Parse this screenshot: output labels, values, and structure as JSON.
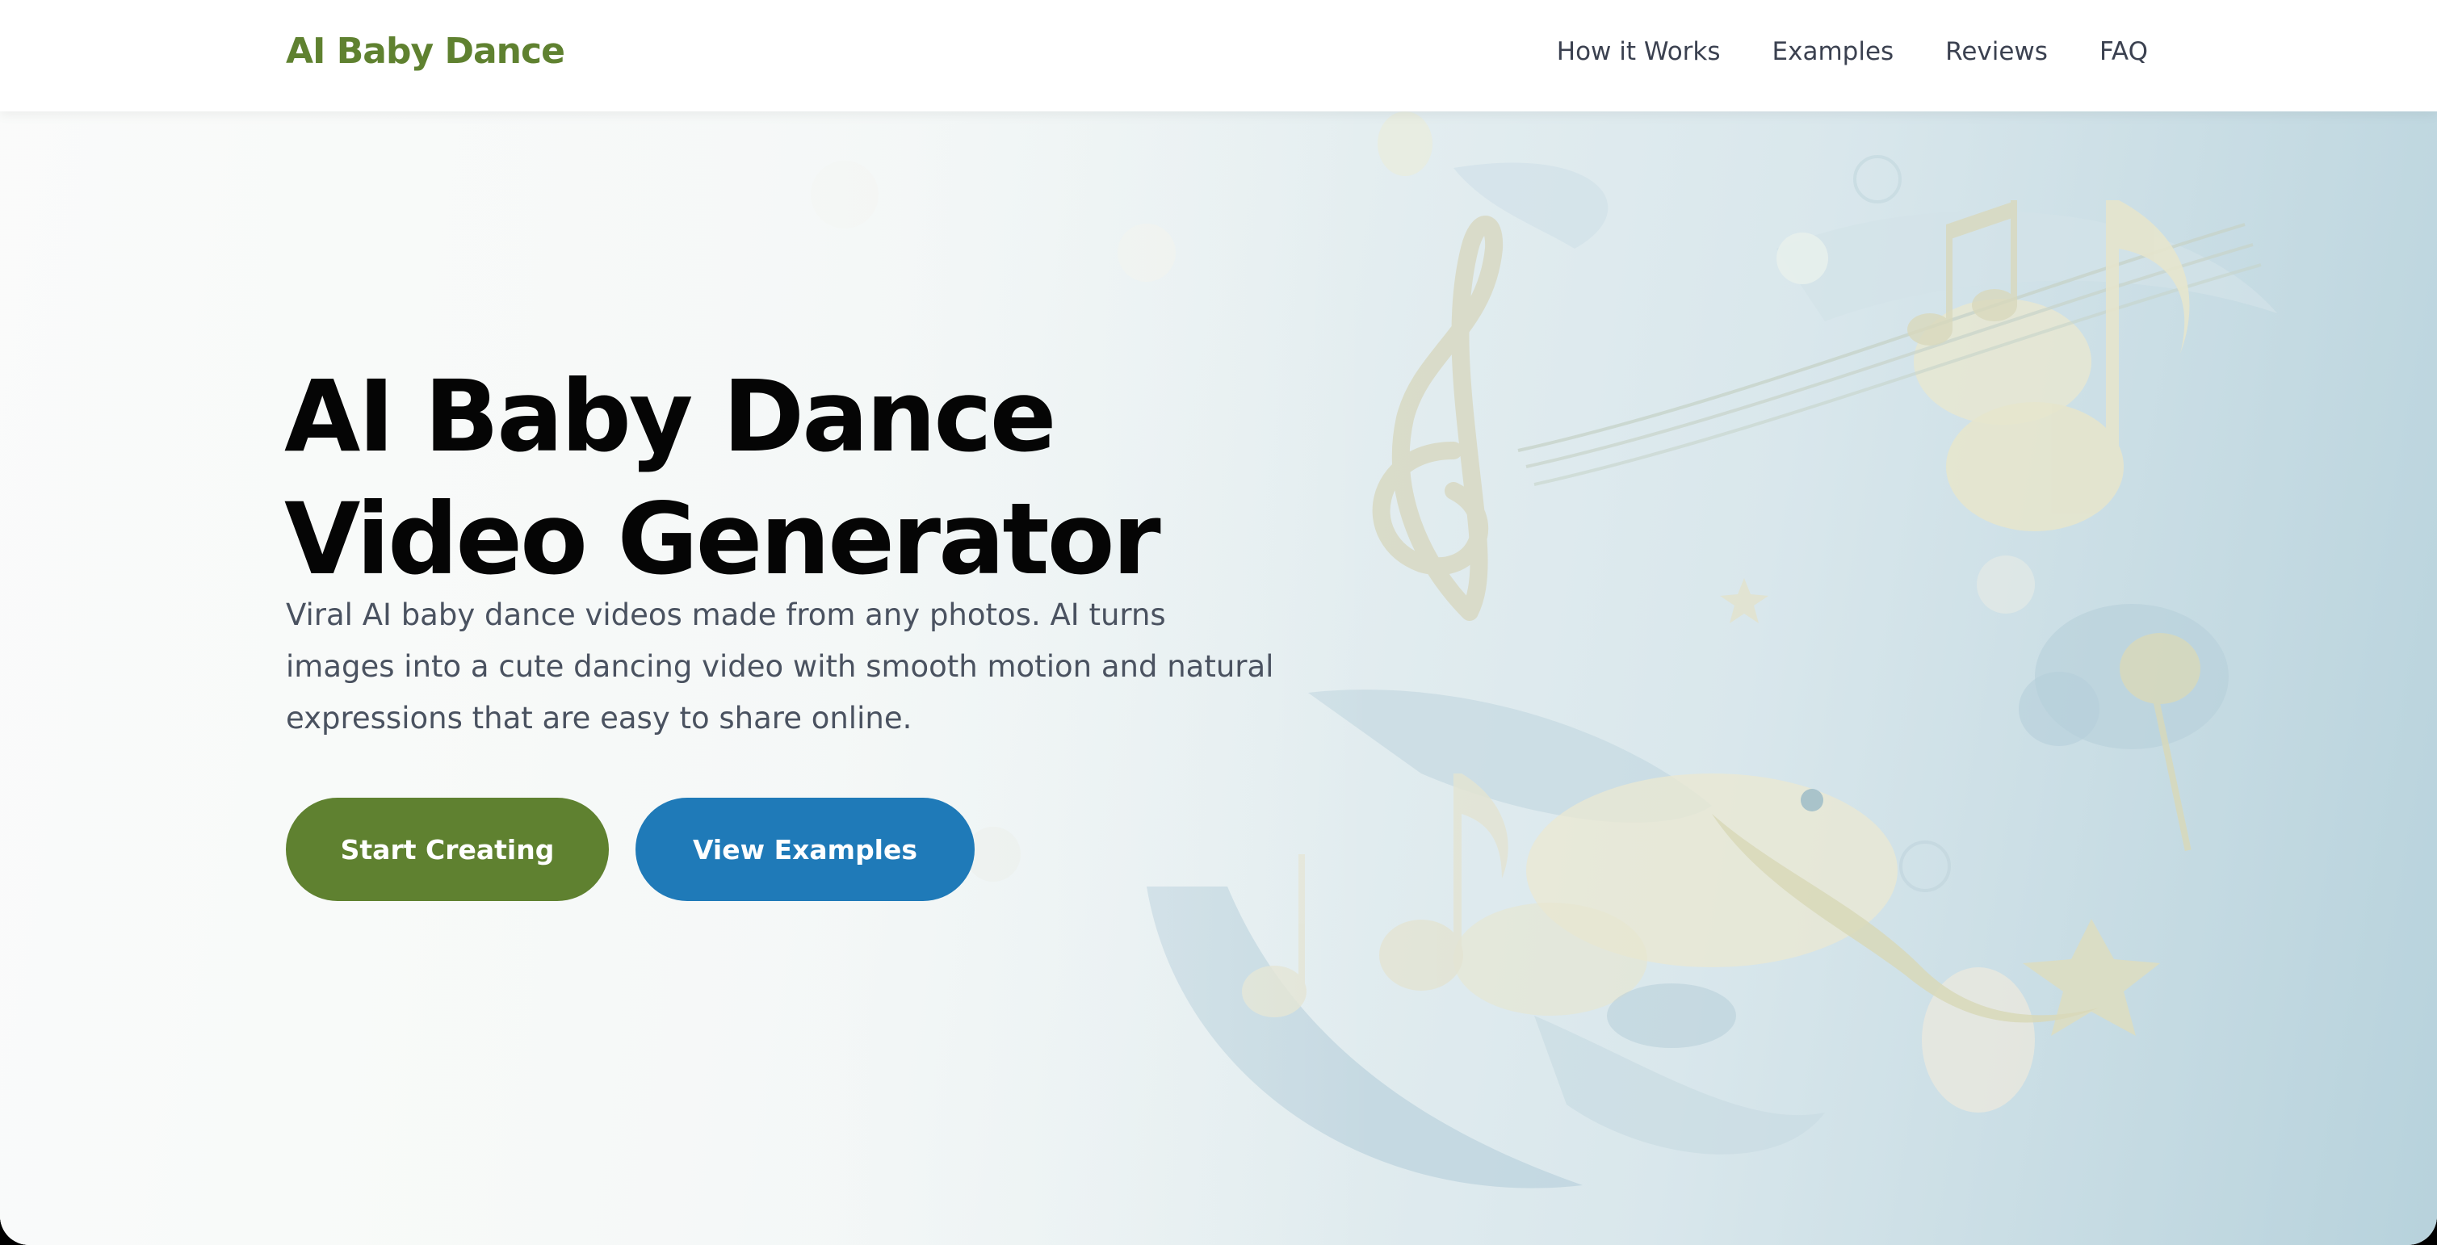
{
  "header": {
    "logo": "AI Baby Dance",
    "nav": [
      "How it Works",
      "Examples",
      "Reviews",
      "FAQ"
    ]
  },
  "hero": {
    "title": "AI Baby Dance Video Generator",
    "subtitle": "Viral AI baby dance videos made from any photos. AI turns images into a cute dancing video with smooth motion and natural expressions that are easy to share online.",
    "primary_button": "Start Creating",
    "secondary_button": "View Examples"
  },
  "colors": {
    "brand_green": "#5f8130",
    "accent_blue": "#1f7ab8",
    "title_text": "#050505",
    "body_text": "#4a5260"
  },
  "icons": {
    "hero_art": [
      "treble-clef-icon",
      "music-note-icon",
      "star-icon",
      "bubble-icon"
    ]
  }
}
